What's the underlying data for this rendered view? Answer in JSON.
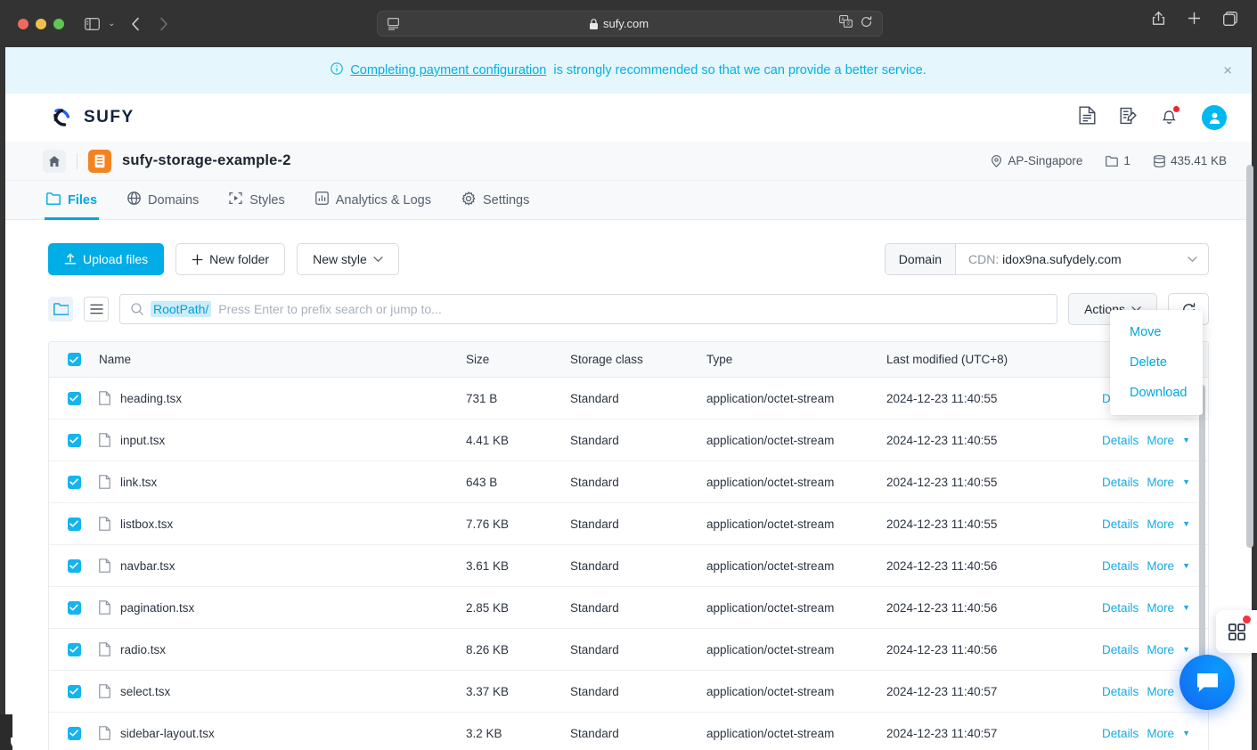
{
  "browser": {
    "url": "sufy.com",
    "sidebar_icon": "sidebar-toggle-icon",
    "back_icon": "back-arrow-icon",
    "forward_icon": "forward-arrow-icon",
    "lock_icon": "lock-icon",
    "reader_icon": "reader-view-icon",
    "translate_icon": "translate-icon",
    "reload_icon": "reload-icon",
    "share_icon": "share-icon",
    "new_tab_icon": "plus-icon",
    "tabs_icon": "tab-overview-icon"
  },
  "banner": {
    "link_text": "Completing payment configuration",
    "rest_text": "is strongly recommended so that we can provide a better service.",
    "close_label": "×",
    "bg": "#e5f6fd",
    "accent": "#00b3e6"
  },
  "topnav": {
    "brand": "SUFY",
    "icons": [
      {
        "name": "document-icon"
      },
      {
        "name": "edit-document-icon"
      },
      {
        "name": "bell-icon"
      }
    ],
    "avatar_name": "user-avatar"
  },
  "bucket": {
    "home_icon": "home-icon",
    "bucket_icon": "bucket-icon",
    "name": "sufy-storage-example-2",
    "region": "AP-Singapore",
    "folder_count": "1",
    "size": "435.41 KB"
  },
  "tabs": [
    {
      "label": "Files",
      "icon": "folder-icon",
      "active": true
    },
    {
      "label": "Domains",
      "icon": "globe-icon",
      "active": false
    },
    {
      "label": "Styles",
      "icon": "styles-icon",
      "active": false
    },
    {
      "label": "Analytics & Logs",
      "icon": "chart-icon",
      "active": false
    },
    {
      "label": "Settings",
      "icon": "gear-icon",
      "active": false
    }
  ],
  "toolbar": {
    "upload_label": "Upload files",
    "new_folder_label": "New folder",
    "new_style_label": "New style",
    "domain_label": "Domain",
    "domain_prefix": "CDN:",
    "domain_value": "idox9na.sufydely.com",
    "primary_color": "#00ade6"
  },
  "search": {
    "prefix_chip": "RootPath/",
    "placeholder": "Press Enter to prefix search or jump to...",
    "actions_label": "Actions",
    "folder_view_icon": "folder-view-icon",
    "list_view_icon": "list-view-icon",
    "refresh_icon": "refresh-icon"
  },
  "actions_menu": {
    "open": true,
    "items": [
      "Move",
      "Delete",
      "Download"
    ]
  },
  "table": {
    "columns": [
      "Name",
      "Size",
      "Storage class",
      "Type",
      "Last modified (UTC+8)"
    ],
    "header_checked": true,
    "row_actions": {
      "details": "Details",
      "more": "More"
    },
    "rows": [
      {
        "checked": true,
        "name": "heading.tsx",
        "size": "731 B",
        "storage_class": "Standard",
        "type": "application/octet-stream",
        "modified": "2024-12-23 11:40:55"
      },
      {
        "checked": true,
        "name": "input.tsx",
        "size": "4.41 KB",
        "storage_class": "Standard",
        "type": "application/octet-stream",
        "modified": "2024-12-23 11:40:55"
      },
      {
        "checked": true,
        "name": "link.tsx",
        "size": "643 B",
        "storage_class": "Standard",
        "type": "application/octet-stream",
        "modified": "2024-12-23 11:40:55"
      },
      {
        "checked": true,
        "name": "listbox.tsx",
        "size": "7.76 KB",
        "storage_class": "Standard",
        "type": "application/octet-stream",
        "modified": "2024-12-23 11:40:55"
      },
      {
        "checked": true,
        "name": "navbar.tsx",
        "size": "3.61 KB",
        "storage_class": "Standard",
        "type": "application/octet-stream",
        "modified": "2024-12-23 11:40:56"
      },
      {
        "checked": true,
        "name": "pagination.tsx",
        "size": "2.85 KB",
        "storage_class": "Standard",
        "type": "application/octet-stream",
        "modified": "2024-12-23 11:40:56"
      },
      {
        "checked": true,
        "name": "radio.tsx",
        "size": "8.26 KB",
        "storage_class": "Standard",
        "type": "application/octet-stream",
        "modified": "2024-12-23 11:40:56"
      },
      {
        "checked": true,
        "name": "select.tsx",
        "size": "3.37 KB",
        "storage_class": "Standard",
        "type": "application/octet-stream",
        "modified": "2024-12-23 11:40:57"
      },
      {
        "checked": true,
        "name": "sidebar-layout.tsx",
        "size": "3.2 KB",
        "storage_class": "Standard",
        "type": "application/octet-stream",
        "modified": "2024-12-23 11:40:57"
      }
    ]
  },
  "widgets": {
    "grid_icon": "apps-grid-icon",
    "chat_icon": "chat-bubble-icon"
  }
}
